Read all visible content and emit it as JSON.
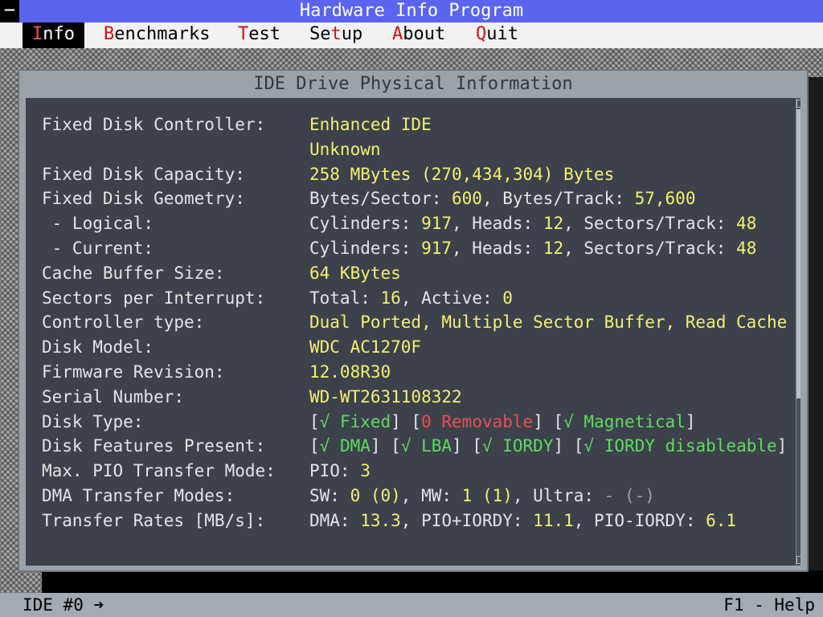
{
  "app": {
    "title": "Hardware Info Program",
    "system_menu_glyph": "−"
  },
  "menu": [
    {
      "hot": "I",
      "rest": "nfo",
      "active": true
    },
    {
      "hot": "B",
      "rest": "enchmarks",
      "active": false
    },
    {
      "hot": "T",
      "rest": "est",
      "active": false
    },
    {
      "hot": "",
      "pre": "Se",
      "hot2": "t",
      "rest": "up",
      "active": false
    },
    {
      "hot": "A",
      "rest": "bout",
      "active": false
    },
    {
      "hot": "Q",
      "rest": "uit",
      "active": false
    }
  ],
  "window": {
    "title": "IDE Drive Physical Information"
  },
  "rows": [
    {
      "label": "Fixed Disk Controller:",
      "value": [
        {
          "t": "Enhanced IDE",
          "c": "y"
        }
      ]
    },
    {
      "label": "",
      "value": [
        {
          "t": "Unknown",
          "c": "y"
        }
      ]
    },
    {
      "label": "Fixed Disk Capacity:",
      "value": [
        {
          "t": "258 MBytes (270,434,304) Bytes",
          "c": "y"
        }
      ]
    },
    {
      "label": "Fixed Disk Geometry:",
      "value": [
        {
          "t": "Bytes/Sector: ",
          "c": "w"
        },
        {
          "t": "600",
          "c": "y"
        },
        {
          "t": ", Bytes/Track: ",
          "c": "w"
        },
        {
          "t": "57,600",
          "c": "y"
        }
      ]
    },
    {
      "label": " - Logical:",
      "value": [
        {
          "t": "Cylinders: ",
          "c": "w"
        },
        {
          "t": "917",
          "c": "y"
        },
        {
          "t": ", Heads: ",
          "c": "w"
        },
        {
          "t": "12",
          "c": "y"
        },
        {
          "t": ", Sectors/Track: ",
          "c": "w"
        },
        {
          "t": "48",
          "c": "y"
        }
      ]
    },
    {
      "label": " - Current:",
      "value": [
        {
          "t": "Cylinders: ",
          "c": "w"
        },
        {
          "t": "917",
          "c": "y"
        },
        {
          "t": ", Heads: ",
          "c": "w"
        },
        {
          "t": "12",
          "c": "y"
        },
        {
          "t": ", Sectors/Track: ",
          "c": "w"
        },
        {
          "t": "48",
          "c": "y"
        }
      ]
    },
    {
      "label": "Cache Buffer Size:",
      "value": [
        {
          "t": "64 KBytes",
          "c": "y"
        }
      ]
    },
    {
      "label": "Sectors per Interrupt:",
      "value": [
        {
          "t": "Total: ",
          "c": "w"
        },
        {
          "t": "16",
          "c": "y"
        },
        {
          "t": ", Active: ",
          "c": "w"
        },
        {
          "t": "0",
          "c": "y"
        }
      ]
    },
    {
      "label": "Controller type:",
      "value": [
        {
          "t": "Dual Ported, Multiple Sector Buffer, Read Cache",
          "c": "y"
        }
      ]
    },
    {
      "label": "Disk Model:",
      "value": [
        {
          "t": "WDC AC1270F",
          "c": "y"
        }
      ]
    },
    {
      "label": "Firmware Revision:",
      "value": [
        {
          "t": "12.08R30",
          "c": "y"
        }
      ]
    },
    {
      "label": "Serial Number:",
      "value": [
        {
          "t": "WD-WT2631108322",
          "c": "y"
        }
      ]
    },
    {
      "label": "Disk Type:",
      "value": [
        {
          "t": "[",
          "c": "w"
        },
        {
          "t": "√ Fixed",
          "c": "g"
        },
        {
          "t": "] [",
          "c": "w"
        },
        {
          "t": "0 Removable",
          "c": "r"
        },
        {
          "t": "] [",
          "c": "w"
        },
        {
          "t": "√ Magnetical",
          "c": "g"
        },
        {
          "t": "]",
          "c": "w"
        }
      ]
    },
    {
      "label": "Disk Features Present:",
      "value": [
        {
          "t": "[",
          "c": "w"
        },
        {
          "t": "√ DMA",
          "c": "g"
        },
        {
          "t": "] [",
          "c": "w"
        },
        {
          "t": "√ LBA",
          "c": "g"
        },
        {
          "t": "] [",
          "c": "w"
        },
        {
          "t": "√ IORDY",
          "c": "g"
        },
        {
          "t": "] [",
          "c": "w"
        },
        {
          "t": "√ IORDY disableable",
          "c": "g"
        },
        {
          "t": "]",
          "c": "w"
        }
      ]
    },
    {
      "label": "Max. PIO Transfer Mode:",
      "value": [
        {
          "t": "PIO: ",
          "c": "w"
        },
        {
          "t": "3",
          "c": "y"
        }
      ]
    },
    {
      "label": "DMA Transfer Modes:",
      "value": [
        {
          "t": "SW: ",
          "c": "w"
        },
        {
          "t": "0 (0)",
          "c": "y"
        },
        {
          "t": ", MW: ",
          "c": "w"
        },
        {
          "t": "1 (1)",
          "c": "y"
        },
        {
          "t": ", Ultra: ",
          "c": "w"
        },
        {
          "t": "- (-)",
          "c": "d"
        }
      ]
    },
    {
      "label": "Transfer Rates [MB/s]:",
      "value": [
        {
          "t": "DMA: ",
          "c": "w"
        },
        {
          "t": "13.3",
          "c": "y"
        },
        {
          "t": ", PIO+IORDY: ",
          "c": "w"
        },
        {
          "t": "11.1",
          "c": "y"
        },
        {
          "t": ", PIO-IORDY: ",
          "c": "w"
        },
        {
          "t": "6.1",
          "c": "y"
        }
      ]
    }
  ],
  "status": {
    "left": "IDE #0 ➜",
    "right": "F1 - Help"
  },
  "colors": {
    "title_bar": "#5a64ee",
    "value_yellow": "#f4f070",
    "check_green": "#5cdc5c",
    "cross_red": "#e85050"
  }
}
